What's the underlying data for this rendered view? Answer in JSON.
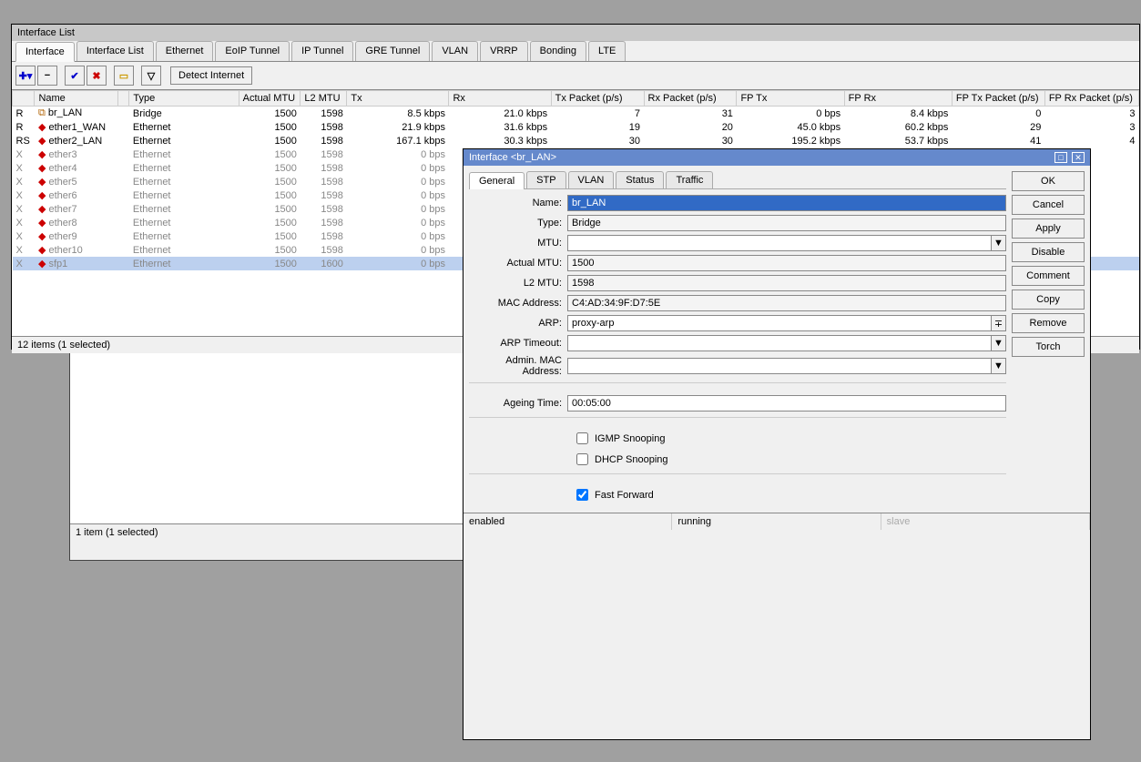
{
  "aux_status": "1 item (1 selected)",
  "list_window": {
    "title": "Interface List",
    "tabs": [
      "Interface",
      "Interface List",
      "Ethernet",
      "EoIP Tunnel",
      "IP Tunnel",
      "GRE Tunnel",
      "VLAN",
      "VRRP",
      "Bonding",
      "LTE"
    ],
    "toolbar": {
      "detect": "Detect Internet"
    },
    "columns": [
      "",
      "Name",
      "",
      "Type",
      "Actual MTU",
      "L2 MTU",
      "Tx",
      "Rx",
      "Tx Packet (p/s)",
      "Rx Packet (p/s)",
      "FP Tx",
      "FP Rx",
      "FP Tx Packet (p/s)",
      "FP Rx Packet (p/s)"
    ],
    "rows": [
      {
        "flag": "R",
        "ico": "br",
        "name": "br_LAN",
        "type": "Bridge",
        "amtu": "1500",
        "l2": "1598",
        "tx": "8.5 kbps",
        "rx": "21.0 kbps",
        "txp": "7",
        "rxp": "31",
        "fptx": "0 bps",
        "fprx": "8.4 kbps",
        "fptxp": "0",
        "fprxp": "3"
      },
      {
        "flag": "R",
        "ico": "eth",
        "name": "ether1_WAN",
        "type": "Ethernet",
        "amtu": "1500",
        "l2": "1598",
        "tx": "21.9 kbps",
        "rx": "31.6 kbps",
        "txp": "19",
        "rxp": "20",
        "fptx": "45.0 kbps",
        "fprx": "60.2 kbps",
        "fptxp": "29",
        "fprxp": "3"
      },
      {
        "flag": "RS",
        "ico": "eth",
        "name": "ether2_LAN",
        "type": "Ethernet",
        "amtu": "1500",
        "l2": "1598",
        "tx": "167.1 kbps",
        "rx": "30.3 kbps",
        "txp": "30",
        "rxp": "30",
        "fptx": "195.2 kbps",
        "fprx": "53.7 kbps",
        "fptxp": "41",
        "fprxp": "4"
      },
      {
        "flag": "X",
        "ico": "eth",
        "name": "ether3",
        "type": "Ethernet",
        "amtu": "1500",
        "l2": "1598",
        "tx": "0 bps",
        "disabled": true
      },
      {
        "flag": "X",
        "ico": "eth",
        "name": "ether4",
        "type": "Ethernet",
        "amtu": "1500",
        "l2": "1598",
        "tx": "0 bps",
        "disabled": true
      },
      {
        "flag": "X",
        "ico": "eth",
        "name": "ether5",
        "type": "Ethernet",
        "amtu": "1500",
        "l2": "1598",
        "tx": "0 bps",
        "disabled": true
      },
      {
        "flag": "X",
        "ico": "eth",
        "name": "ether6",
        "type": "Ethernet",
        "amtu": "1500",
        "l2": "1598",
        "tx": "0 bps",
        "disabled": true
      },
      {
        "flag": "X",
        "ico": "eth",
        "name": "ether7",
        "type": "Ethernet",
        "amtu": "1500",
        "l2": "1598",
        "tx": "0 bps",
        "disabled": true
      },
      {
        "flag": "X",
        "ico": "eth",
        "name": "ether8",
        "type": "Ethernet",
        "amtu": "1500",
        "l2": "1598",
        "tx": "0 bps",
        "disabled": true
      },
      {
        "flag": "X",
        "ico": "eth",
        "name": "ether9",
        "type": "Ethernet",
        "amtu": "1500",
        "l2": "1598",
        "tx": "0 bps",
        "disabled": true
      },
      {
        "flag": "X",
        "ico": "eth",
        "name": "ether10",
        "type": "Ethernet",
        "amtu": "1500",
        "l2": "1598",
        "tx": "0 bps",
        "disabled": true
      },
      {
        "flag": "X",
        "ico": "eth",
        "name": "sfp1",
        "type": "Ethernet",
        "amtu": "1500",
        "l2": "1600",
        "tx": "0 bps",
        "disabled": true,
        "selected": true
      }
    ],
    "status": "12 items (1 selected)"
  },
  "dialog": {
    "title": "Interface <br_LAN>",
    "tabs": [
      "General",
      "STP",
      "VLAN",
      "Status",
      "Traffic"
    ],
    "fields": {
      "name_label": "Name:",
      "name_value": "br_LAN",
      "type_label": "Type:",
      "type_value": "Bridge",
      "mtu_label": "MTU:",
      "mtu_value": "",
      "amtu_label": "Actual MTU:",
      "amtu_value": "1500",
      "l2_label": "L2 MTU:",
      "l2_value": "1598",
      "mac_label": "MAC Address:",
      "mac_value": "C4:AD:34:9F:D7:5E",
      "arp_label": "ARP:",
      "arp_value": "proxy-arp",
      "arpt_label": "ARP Timeout:",
      "arpt_value": "",
      "amac_label": "Admin. MAC Address:",
      "amac_value": "",
      "age_label": "Ageing Time:",
      "age_value": "00:05:00",
      "igmp": "IGMP Snooping",
      "dhcp": "DHCP Snooping",
      "ff": "Fast Forward"
    },
    "buttons": [
      "OK",
      "Cancel",
      "Apply",
      "Disable",
      "Comment",
      "Copy",
      "Remove",
      "Torch"
    ],
    "status": {
      "enabled": "enabled",
      "running": "running",
      "slave": "slave"
    }
  }
}
